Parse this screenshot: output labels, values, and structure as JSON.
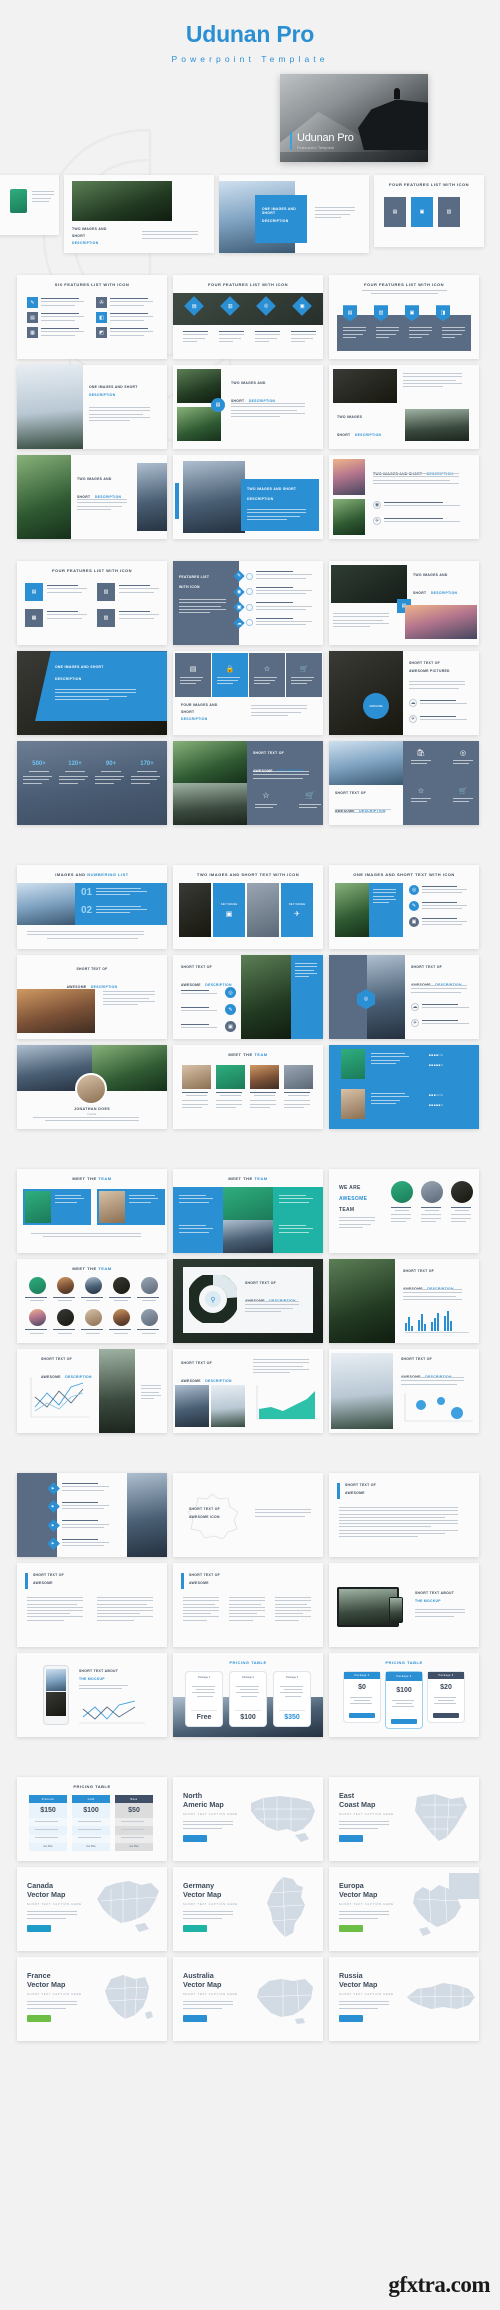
{
  "header": {
    "title": "Udunan Pro",
    "subtitle": "Powerpoint Template",
    "accent_color": "#2b8fd4",
    "page_background": "#f2f2f2"
  },
  "hero": {
    "slide_title": "Udunan Pro",
    "slide_subtitle": "Powerpoint Template"
  },
  "watermark": "gfxtra.com",
  "sections": [
    {
      "name": "intro-row",
      "slides": [
        {
          "title": "",
          "caption": ""
        },
        {
          "title": "TWO IMAGES AND SHORT",
          "caption": "DESCRIPTION"
        },
        {
          "title": "ONE IMAGES AND SHORT",
          "caption": "DESCRIPTION"
        },
        {
          "title": "FOUR FEATURES LIST WITH ICON",
          "caption": ""
        }
      ]
    },
    {
      "name": "features-row",
      "slides": [
        {
          "title": "SIX FEATURES LIST WITH ICON"
        },
        {
          "title": "FOUR FEATURES LIST WITH ICON"
        },
        {
          "title": "FOUR FEATURES LIST WITH ICON"
        }
      ]
    }
  ],
  "slide_titles": {
    "six_features": "SIX FEATURES LIST WITH ICON",
    "four_features": "FOUR FEATURES LIST WITH ICON",
    "one_image_short": "ONE IMAGES AND SHORT",
    "two_images_short": "TWO IMAGES AND",
    "description": "DESCRIPTION",
    "short": "SHORT",
    "two_images_desc": "TWO IMAGES",
    "two_images_and_short": "TWO IMAGES AND SHORT",
    "features_list_with_icon": "FEATURES LIST",
    "with_icon": "WITH ICON",
    "short_text_of": "SHORT TEXT OF",
    "awesome_pictured": "AWESOME PICTURED",
    "awesome": "AWESOME",
    "awesome_icon": "AWESOME ICON",
    "four_images_and": "FOUR IMAGES AND",
    "images_and_numbering": "IMAGES AND",
    "numbering_list": "NUMBERING LIST",
    "two_images_short_text_icon": "TWO IMAGES AND SHORT TEXT WITH ICON",
    "one_images_short_text_icon": "ONE IMAGES AND SHORT TEXT WITH ICON",
    "meet_the_team": "MEET THE",
    "team": "TEAM",
    "we_are": "WE ARE",
    "awesome_team_1": "AWESOME",
    "awesome_team_2": "TEAM",
    "short_text_about": "SHORT TEXT ABOUT",
    "the_mockup": "THE MOCKUP",
    "pricing_table": "PRICING TABLE",
    "numbering_01": "01",
    "numbering_02": "02"
  },
  "pricing": {
    "table_a": {
      "title": "PRICING TABLE",
      "packages": [
        {
          "name": "Package 1",
          "price": "Free"
        },
        {
          "name": "Package 2",
          "price": "$100"
        },
        {
          "name": "Package 3",
          "price": "$350"
        }
      ]
    },
    "table_b": {
      "title": "PRICING TABLE",
      "packages": [
        {
          "name": "Package 1",
          "price": "$0",
          "highlight": false
        },
        {
          "name": "Package 2",
          "price": "$100",
          "highlight": true
        },
        {
          "name": "Package 3",
          "price": "$20",
          "highlight": false
        }
      ]
    },
    "table_c": {
      "title": "PRICING TABLE",
      "packages": [
        {
          "name": "Premium",
          "price": "$150",
          "color": "#2b8fd4"
        },
        {
          "name": "Gold",
          "price": "$100",
          "color": "#2b8fd4"
        },
        {
          "name": "Base",
          "price": "$50",
          "color": "#4a5b73"
        }
      ]
    }
  },
  "stats": {
    "values": [
      "500+",
      "120+",
      "90+",
      "170+"
    ]
  },
  "maps": [
    {
      "line1": "North",
      "line2": "Americ Map",
      "sub": "SHORT TEXT CAPTION HERE",
      "button": "READ MORE",
      "button_color": "#2b8fd4",
      "shape": "usa"
    },
    {
      "line1": "East",
      "line2": "Coast Map",
      "sub": "SHORT TEXT CAPTION HERE",
      "button": "READ MORE",
      "button_color": "#2b8fd4",
      "shape": "east"
    },
    {
      "line1": "Canada",
      "line2": "Vector Map",
      "sub": "SHORT TEXT CAPTION HERE",
      "button": "READ MORE",
      "button_color": "#1f9bc9",
      "shape": "canada"
    },
    {
      "line1": "Germany",
      "line2": "Vector Map",
      "sub": "SHORT TEXT CAPTION HERE",
      "button": "READ MORE",
      "button_color": "#1fb3a5",
      "shape": "germany"
    },
    {
      "line1": "Europa",
      "line2": "Vector Map",
      "sub": "SHORT TEXT CAPTION HERE",
      "button": "READ MORE",
      "button_color": "#6cbe45",
      "shape": "europe"
    },
    {
      "line1": "France",
      "line2": "Vector Map",
      "sub": "SHORT TEXT CAPTION HERE",
      "button": "READ MORE",
      "button_color": "#6cbe45",
      "shape": "france"
    },
    {
      "line1": "Australia",
      "line2": "Vector Map",
      "sub": "SHORT TEXT CAPTION HERE",
      "button": "READ MORE",
      "button_color": "#2b8fd4",
      "shape": "australia"
    },
    {
      "line1": "Russia",
      "line2": "Vector Map",
      "sub": "SHORT TEXT CAPTION HERE",
      "button": "READ MORE",
      "button_color": "#2b8fd4",
      "shape": "russia"
    }
  ],
  "team_names": [
    "JONATHAN DOES",
    "VIKTOR HORN",
    "SARAH BLACK",
    "MIKE ROSS",
    "ELENA DUNNE"
  ],
  "team_role": "Founder"
}
